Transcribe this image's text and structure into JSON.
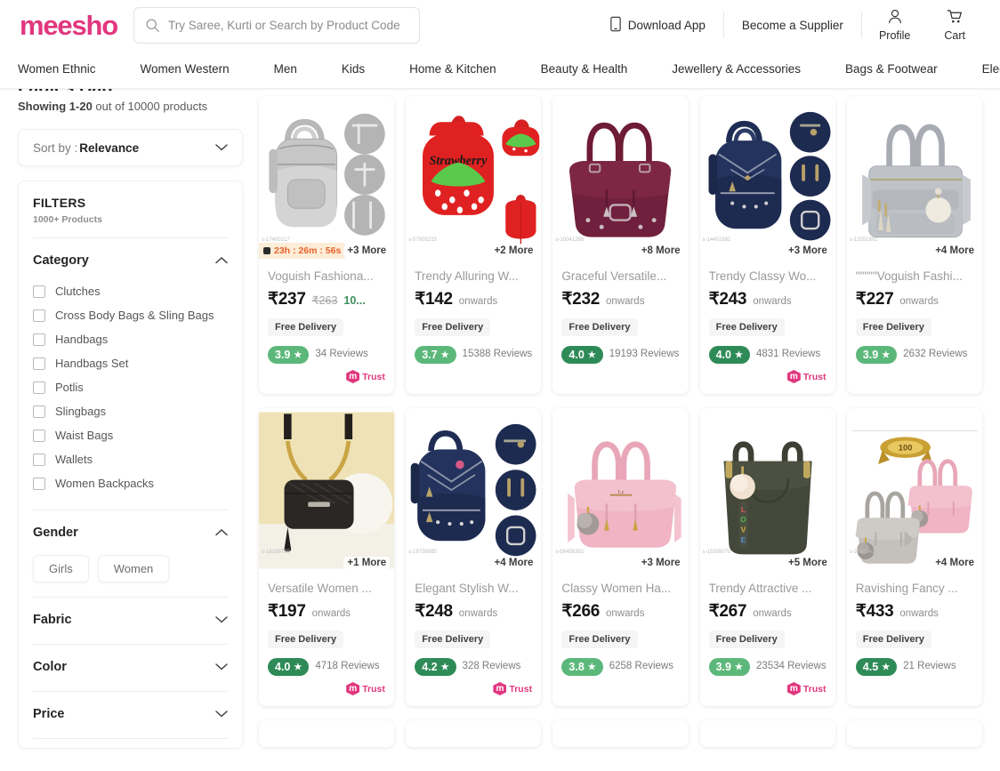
{
  "header": {
    "logo": "meesho",
    "search_placeholder": "Try Saree, Kurti or Search by Product Code",
    "search_value": "",
    "download_app": "Download App",
    "become_supplier": "Become a Supplier",
    "profile": "Profile",
    "cart": "Cart"
  },
  "nav": {
    "items": [
      "Women Ethnic",
      "Women Western",
      "Men",
      "Kids",
      "Home & Kitchen",
      "Beauty & Health",
      "Jewellery & Accessories",
      "Bags & Footwear",
      "Electronics"
    ]
  },
  "listing": {
    "page_title": "Ladies Bag",
    "showing_prefix": "Showing ",
    "showing_range": "1-20",
    "showing_suffix": " out of 10000 products"
  },
  "sort": {
    "label": "Sort by : ",
    "value": "Relevance"
  },
  "filters": {
    "title": "FILTERS",
    "subtitle": "1000+ Products",
    "category": {
      "title": "Category",
      "options": [
        "Clutches",
        "Cross Body Bags & Sling Bags",
        "Handbags",
        "Handbags Set",
        "Potlis",
        "Slingbags",
        "Waist Bags",
        "Wallets",
        "Women Backpacks"
      ]
    },
    "gender": {
      "title": "Gender",
      "chips": [
        "Girls",
        "Women"
      ]
    },
    "fabric": {
      "title": "Fabric"
    },
    "color": {
      "title": "Color"
    },
    "price": {
      "title": "Price"
    }
  },
  "labels": {
    "free_delivery": "Free Delivery",
    "onwards": "onwards",
    "trust": "Trusted"
  },
  "products": [
    {
      "title": "Voguish Fashiona...",
      "price": "₹237",
      "strike": "₹263",
      "discount": "10...",
      "onwards": false,
      "free_delivery": "Free Delivery",
      "rating": "3.9",
      "rating_color": "#5cb87a",
      "reviews": "34 Reviews",
      "more": "+3 More",
      "timer": "23h : 26m : 56s",
      "trust": true,
      "code": "s-17400217",
      "art": "grey-backpack"
    },
    {
      "title": "Trendy Alluring W...",
      "price": "₹142",
      "strike": "",
      "discount": "",
      "onwards": true,
      "free_delivery": "Free Delivery",
      "rating": "3.7",
      "rating_color": "#5cb87a",
      "reviews": "15388 Reviews",
      "more": "+2 More",
      "timer": "",
      "trust": false,
      "code": "s-57805215",
      "art": "strawberry-bag"
    },
    {
      "title": "Graceful Versatile...",
      "price": "₹232",
      "strike": "",
      "discount": "",
      "onwards": true,
      "free_delivery": "Free Delivery",
      "rating": "4.0",
      "rating_color": "#2e8b57",
      "reviews": "19193 Reviews",
      "more": "+8 More",
      "timer": "",
      "trust": false,
      "code": "s-10041288",
      "art": "maroon-handbag"
    },
    {
      "title": "Trendy Classy Wo...",
      "price": "₹243",
      "strike": "",
      "discount": "",
      "onwards": true,
      "free_delivery": "Free Delivery",
      "rating": "4.0",
      "rating_color": "#2e8b57",
      "reviews": "4831 Reviews",
      "more": "+3 More",
      "timer": "",
      "trust": true,
      "code": "s-14451581",
      "art": "navy-backpack"
    },
    {
      "title": "\"\"\"\"\"Voguish Fashi...",
      "price": "₹227",
      "strike": "",
      "discount": "",
      "onwards": true,
      "free_delivery": "Free Delivery",
      "rating": "3.9",
      "rating_color": "#5cb87a",
      "reviews": "2632 Reviews",
      "more": "+4 More",
      "timer": "",
      "trust": false,
      "code": "s-12551801",
      "art": "grey-tote"
    },
    {
      "title": "Versatile Women ...",
      "price": "₹197",
      "strike": "",
      "discount": "",
      "onwards": true,
      "free_delivery": "Free Delivery",
      "rating": "4.0",
      "rating_color": "#2e8b57",
      "reviews": "4718 Reviews",
      "more": "+1 More",
      "timer": "",
      "trust": true,
      "code": "s-16199709",
      "art": "black-sling"
    },
    {
      "title": "Elegant Stylish W...",
      "price": "₹248",
      "strike": "",
      "discount": "",
      "onwards": true,
      "free_delivery": "Free Delivery",
      "rating": "4.2",
      "rating_color": "#2e8b57",
      "reviews": "328 Reviews",
      "more": "+4 More",
      "timer": "",
      "trust": true,
      "code": "s-19738085",
      "art": "navy-backpack2"
    },
    {
      "title": "Classy Women Ha...",
      "price": "₹266",
      "strike": "",
      "discount": "",
      "onwards": true,
      "free_delivery": "Free Delivery",
      "rating": "3.8",
      "rating_color": "#5cb87a",
      "reviews": "6258 Reviews",
      "more": "+3 More",
      "timer": "",
      "trust": false,
      "code": "s-56458392",
      "art": "pink-handbag"
    },
    {
      "title": "Trendy Attractive ...",
      "price": "₹267",
      "strike": "",
      "discount": "",
      "onwards": true,
      "free_delivery": "Free Delivery",
      "rating": "3.9",
      "rating_color": "#5cb87a",
      "reviews": "23534 Reviews",
      "more": "+5 More",
      "timer": "",
      "trust": true,
      "code": "s-15305070",
      "art": "olive-tote"
    },
    {
      "title": "Ravishing Fancy ...",
      "price": "₹433",
      "strike": "",
      "discount": "",
      "onwards": true,
      "free_delivery": "Free Delivery",
      "rating": "4.5",
      "rating_color": "#2e8b57",
      "reviews": "21 Reviews",
      "more": "+4 More",
      "timer": "",
      "trust": false,
      "code": "s-20463431",
      "art": "twin-handbags"
    }
  ],
  "colors": {
    "brand": "#e1377e",
    "rating_light": "#5cb87a",
    "rating_dark": "#2e8b57",
    "discount_green": "#3d8f5b",
    "timer_bg": "#fdecd7",
    "timer_text": "#e8622b"
  }
}
